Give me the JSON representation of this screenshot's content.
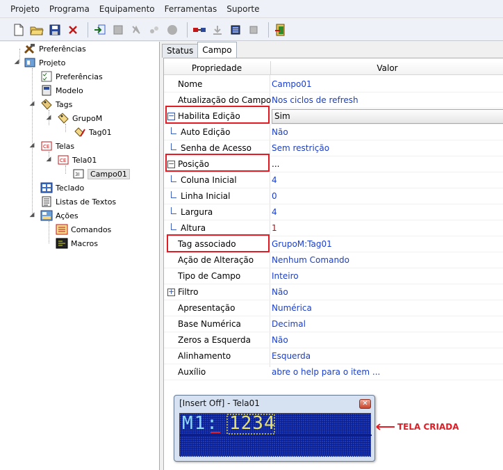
{
  "menu": [
    "Projeto",
    "Programa",
    "Equipamento",
    "Ferramentas",
    "Suporte"
  ],
  "tree": {
    "preferencias_root": "Preferências",
    "projeto": "Projeto",
    "preferencias": "Preferências",
    "modelo": "Modelo",
    "tags": "Tags",
    "grupo": "GrupoM",
    "tag01": "Tag01",
    "telas": "Telas",
    "tela01": "Tela01",
    "campo01": "Campo01",
    "teclado": "Teclado",
    "listas": "Listas de Textos",
    "acoes": "Ações",
    "comandos": "Comandos",
    "macros": "Macros"
  },
  "tabs": [
    "Status",
    "Campo"
  ],
  "grid": {
    "header_prop": "Propriedade",
    "header_val": "Valor",
    "rows": [
      {
        "name": "Nome",
        "value": "Campo01"
      },
      {
        "name": "Atualização do Campo",
        "value": "Nos ciclos de refresh"
      },
      {
        "name": "Habilita Edição",
        "value": "Sim"
      },
      {
        "name": "Auto Edição",
        "value": "Não"
      },
      {
        "name": "Senha de Acesso",
        "value": "Sem restrição"
      },
      {
        "name": "Posição",
        "value": "..."
      },
      {
        "name": "Coluna Inicial",
        "value": "4"
      },
      {
        "name": "Linha Inicial",
        "value": "0"
      },
      {
        "name": "Largura",
        "value": "4"
      },
      {
        "name": "Altura",
        "value": "1"
      },
      {
        "name": "Tag associado",
        "value": "GrupoM:Tag01"
      },
      {
        "name": "Ação de Alteração",
        "value": "Nenhum Comando"
      },
      {
        "name": "Tipo de Campo",
        "value": "Inteiro"
      },
      {
        "name": "Filtro",
        "value": "Não"
      },
      {
        "name": "Apresentação",
        "value": "Numérica"
      },
      {
        "name": "Base Numérica",
        "value": "Decimal"
      },
      {
        "name": "Zeros a Esquerda",
        "value": "Não"
      },
      {
        "name": "Alinhamento",
        "value": "Esquerda"
      },
      {
        "name": "Auxílio",
        "value": "abre o help para o item ..."
      }
    ]
  },
  "window": {
    "title": "[Insert Off] - Tela01",
    "lcd_left": "M1:",
    "lcd_field": "1234"
  },
  "annotation": "TELA CRIADA",
  "colors": {
    "highlight": "#e01c24",
    "value_text": "#1a3ec8",
    "lcd_bg": "#0c1e8a"
  }
}
